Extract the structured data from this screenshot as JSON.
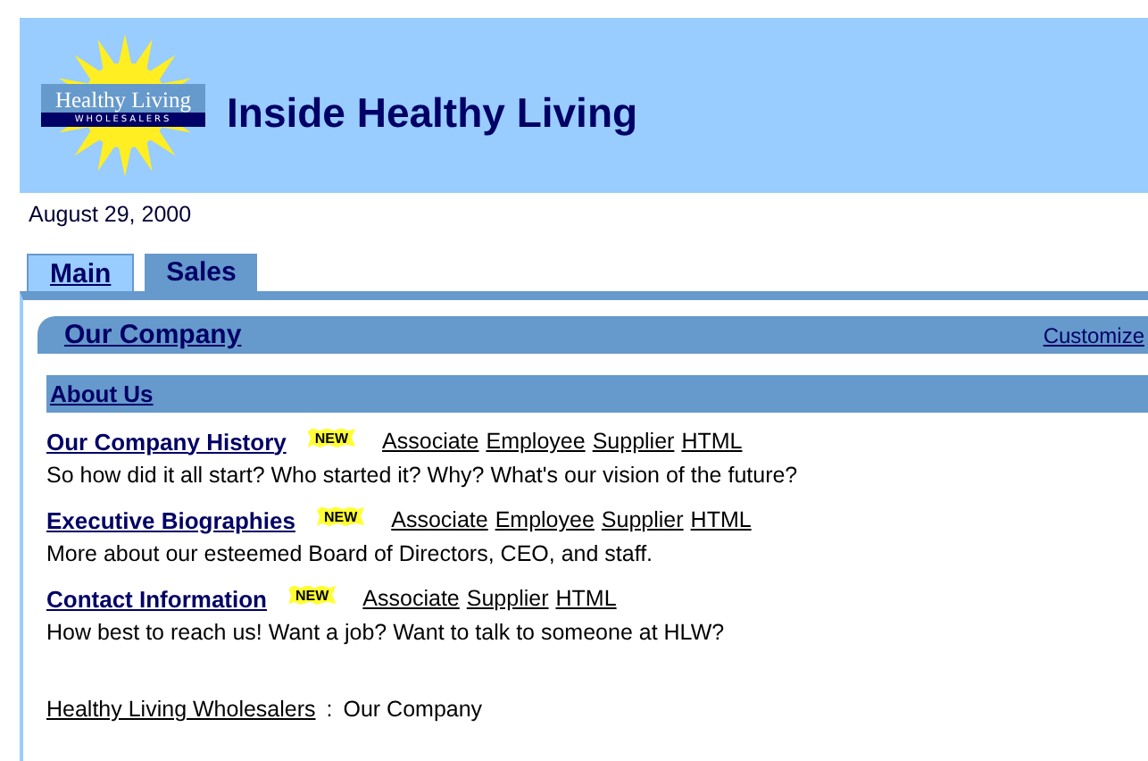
{
  "header": {
    "logo_text": "Healthy Living",
    "logo_subtext": "WHOLESALERS",
    "title": "Inside Healthy Living"
  },
  "date": "August 29, 2000",
  "tabs": [
    {
      "label": "Main",
      "selected": false
    },
    {
      "label": "Sales",
      "selected": true
    }
  ],
  "portlet": {
    "title": "Our Company",
    "action": "Customize",
    "section": "About Us",
    "items": [
      {
        "title": "Our Company History",
        "badge": "NEW",
        "links": [
          "Associate",
          "Employee",
          "Supplier",
          "HTML"
        ],
        "description": "So how did it all start? Who started it? Why? What's our vision of the future?"
      },
      {
        "title": "Executive Biographies",
        "badge": "NEW",
        "links": [
          "Associate",
          "Employee",
          "Supplier",
          "HTML"
        ],
        "description": "More about our esteemed Board of Directors, CEO, and staff."
      },
      {
        "title": "Contact Information",
        "badge": "NEW",
        "links": [
          "Associate",
          "Supplier",
          "HTML"
        ],
        "description": "How best to reach us! Want a job? Want to talk to someone at HLW?"
      }
    ]
  },
  "breadcrumb": {
    "link": "Healthy Living Wholesalers",
    "separator": ":",
    "current": "Our Company"
  }
}
